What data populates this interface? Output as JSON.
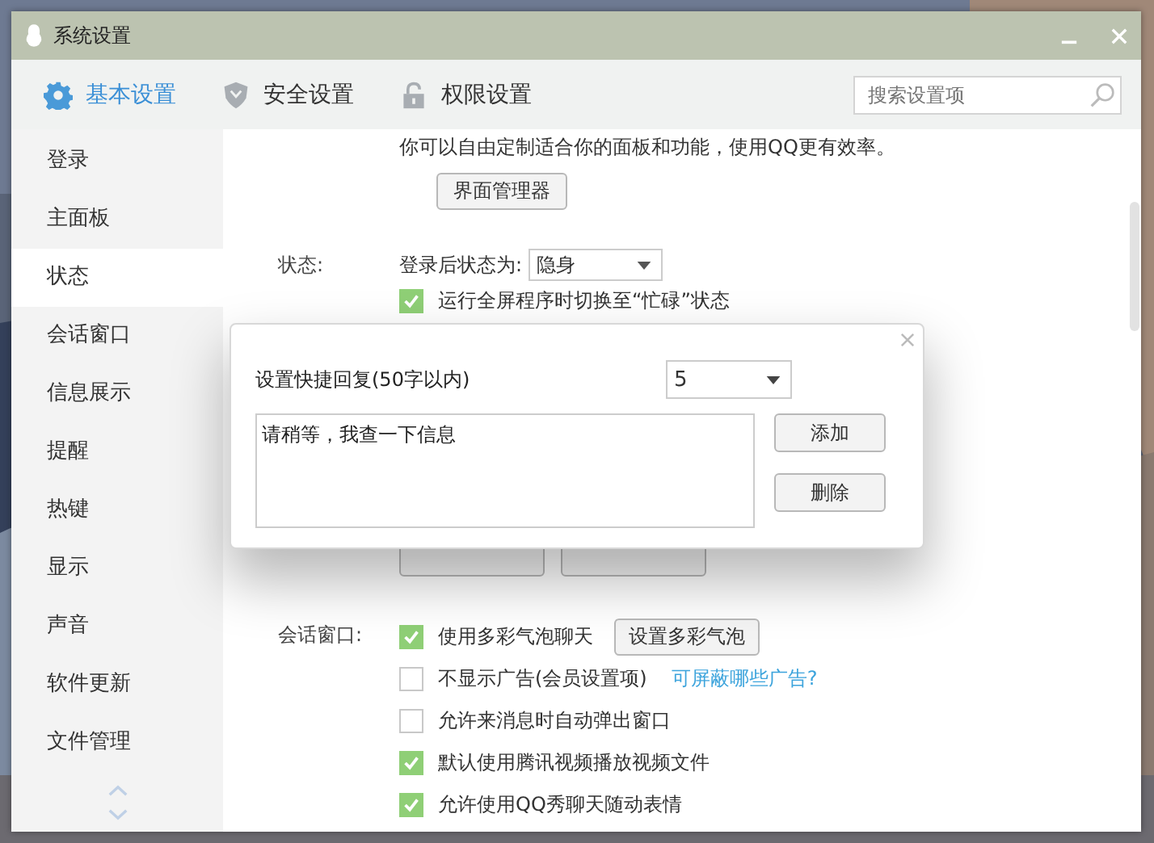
{
  "window": {
    "title": "系统设置"
  },
  "tabs": [
    {
      "label": "基本设置",
      "selected": true
    },
    {
      "label": "安全设置",
      "selected": false
    },
    {
      "label": "权限设置",
      "selected": false
    }
  ],
  "search": {
    "placeholder": "搜索设置项"
  },
  "sidebar": {
    "items": [
      {
        "label": "登录",
        "selected": false
      },
      {
        "label": "主面板",
        "selected": false
      },
      {
        "label": "状态",
        "selected": true
      },
      {
        "label": "会话窗口",
        "selected": false
      },
      {
        "label": "信息展示",
        "selected": false
      },
      {
        "label": "提醒",
        "selected": false
      },
      {
        "label": "热键",
        "selected": false
      },
      {
        "label": "显示",
        "selected": false
      },
      {
        "label": "声音",
        "selected": false
      },
      {
        "label": "软件更新",
        "selected": false
      },
      {
        "label": "文件管理",
        "selected": false
      }
    ]
  },
  "content": {
    "intro": "你可以自由定制适合你的面板和功能，使用QQ更有效率。",
    "interface_button": "界面管理器",
    "status": {
      "label": "状态:",
      "login_status_label": "登录后状态为:",
      "login_status_value": "隐身",
      "options": [
        {
          "label": "运行全屏程序时切换至“忙碌”状态",
          "checked": true
        }
      ]
    },
    "chat_window": {
      "label": "会话窗口:",
      "options": [
        {
          "label": "使用多彩气泡聊天",
          "checked": true,
          "button": "设置多彩气泡"
        },
        {
          "label": "不显示广告(会员设置项)",
          "checked": false,
          "link": "可屏蔽哪些广告?"
        },
        {
          "label": "允许来消息时自动弹出窗口",
          "checked": false
        },
        {
          "label": "默认使用腾讯视频播放视频文件",
          "checked": true
        },
        {
          "label": "允许使用QQ秀聊天随动表情",
          "checked": true
        }
      ]
    }
  },
  "dialog": {
    "label": "设置快捷回复(50字以内)",
    "number_value": "5",
    "reply_text": "请稍等，我查一下信息",
    "buttons": [
      "添加",
      "删除"
    ]
  }
}
